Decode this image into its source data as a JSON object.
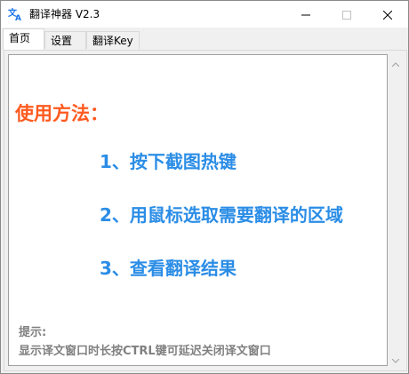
{
  "window": {
    "title": "翻译神器 V2.3",
    "app_icon": "translate-icon"
  },
  "controls": {
    "minimize_icon": "minimize-icon",
    "maximize_icon": "maximize-icon",
    "close_icon": "close-icon"
  },
  "tabs": [
    {
      "label": "首页",
      "active": true
    },
    {
      "label": "设置",
      "active": false
    },
    {
      "label": "翻译Key",
      "active": false
    }
  ],
  "main": {
    "heading": "使用方法：",
    "steps": [
      "1、按下截图热键",
      "2、用鼠标选取需要翻译的区域",
      "3、查看翻译结果"
    ],
    "tip_label": "提示:",
    "tip_text": "显示译文窗口时长按CTRL键可延迟关闭译文窗口"
  },
  "colors": {
    "heading": "#ff5a1f",
    "steps": "#2b8de6",
    "tip": "#808080"
  }
}
